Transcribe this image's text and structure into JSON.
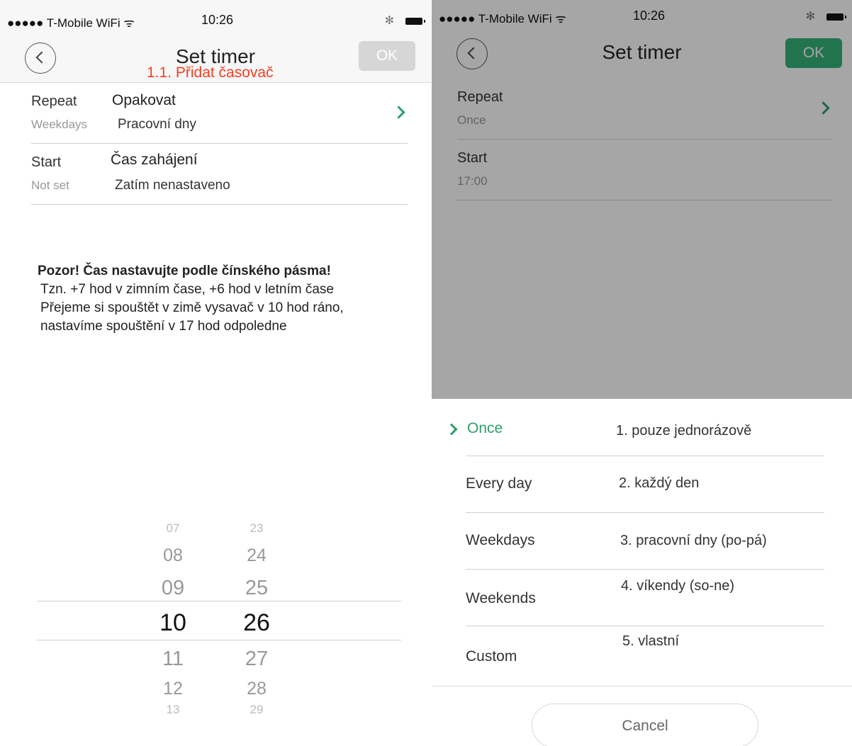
{
  "colors": {
    "accent": "#2e9e6c",
    "annotation": "#f44020",
    "ok_disabled": "#d6d6d6",
    "ok_enabled": "#35b37a"
  },
  "left": {
    "status": {
      "carrier": "●●●●● T-Mobile WiFi ᯤ",
      "time": "10:26",
      "bluetooth": "✻"
    },
    "nav": {
      "title": "Set timer",
      "annotation": "1.1. Přidat časovač",
      "ok_label": "OK"
    },
    "repeat": {
      "label": "Repeat",
      "value": "Weekdays",
      "cz_label": "Opakovat",
      "cz_value": "Pracovní dny"
    },
    "start": {
      "label": "Start",
      "value": "Not set",
      "cz_label": "Čas zahájení",
      "cz_value": "Zatím nenastaveno"
    },
    "note": {
      "heading": "Pozor! Čas nastavujte podle čínského pásma!",
      "line1": "Tzn. +7 hod v zimním čase, +6 hod v letním čase",
      "line2": "Přejeme si spouštět v zimě vysavač v 10 hod ráno,",
      "line3": "nastavíme spouštění v 17 hod odpoledne"
    },
    "picker": {
      "hours": [
        "07",
        "08",
        "09",
        "10",
        "11",
        "12",
        "13"
      ],
      "minutes": [
        "23",
        "24",
        "25",
        "26",
        "27",
        "28",
        "29"
      ],
      "selected_index": 3
    }
  },
  "right": {
    "status": {
      "carrier": "●●●●● T-Mobile WiFi ᯤ",
      "time": "10:26",
      "bluetooth": "✻"
    },
    "nav": {
      "title": "Set timer",
      "ok_label": "OK"
    },
    "repeat": {
      "label": "Repeat",
      "value": "Once"
    },
    "start": {
      "label": "Start",
      "value": "17:00"
    },
    "options": [
      {
        "label": "Once",
        "cz": "1. pouze jednorázově",
        "selected": true
      },
      {
        "label": "Every day",
        "cz": "2. každý den",
        "selected": false
      },
      {
        "label": "Weekdays",
        "cz": "3. pracovní dny (po-pá)",
        "selected": false
      },
      {
        "label": "Weekends",
        "cz": "4. víkendy (so-ne)",
        "selected": false
      },
      {
        "label": "Custom",
        "cz": "5. vlastní",
        "selected": false
      }
    ],
    "cancel_label": "Cancel"
  }
}
